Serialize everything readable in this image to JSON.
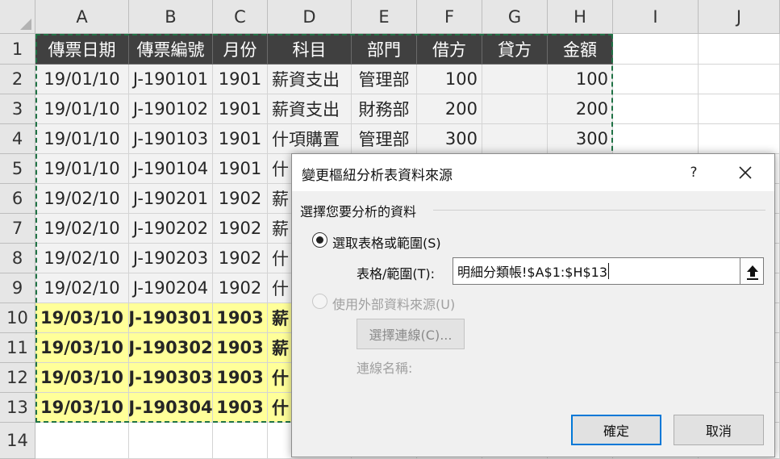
{
  "columns": [
    "A",
    "B",
    "C",
    "D",
    "E",
    "F",
    "G",
    "H",
    "I",
    "J"
  ],
  "rows": [
    "1",
    "2",
    "3",
    "4",
    "5",
    "6",
    "7",
    "8",
    "9",
    "10",
    "11",
    "12",
    "13",
    "14"
  ],
  "headers": [
    "傳票日期",
    "傳票編號",
    "月份",
    "科目",
    "部門",
    "借方",
    "貸方",
    "金額"
  ],
  "data_rows": [
    [
      "19/01/10",
      "J-190101",
      "1901",
      "薪資支出",
      "管理部",
      "100",
      "",
      "100"
    ],
    [
      "19/01/10",
      "J-190102",
      "1901",
      "薪資支出",
      "財務部",
      "200",
      "",
      "200"
    ],
    [
      "19/01/10",
      "J-190103",
      "1901",
      "什項購置",
      "管理部",
      "300",
      "",
      "300"
    ],
    [
      "19/01/10",
      "J-190104",
      "1901",
      "什",
      "",
      "",
      "",
      ""
    ],
    [
      "19/02/10",
      "J-190201",
      "1902",
      "薪",
      "",
      "",
      "",
      ""
    ],
    [
      "19/02/10",
      "J-190202",
      "1902",
      "薪",
      "",
      "",
      "",
      ""
    ],
    [
      "19/02/10",
      "J-190203",
      "1902",
      "什",
      "",
      "",
      "",
      ""
    ],
    [
      "19/02/10",
      "J-190204",
      "1902",
      "什",
      "",
      "",
      "",
      ""
    ],
    [
      "19/03/10",
      "J-190301",
      "1903",
      "薪",
      "",
      "",
      "",
      ""
    ],
    [
      "19/03/10",
      "J-190302",
      "1903",
      "薪",
      "",
      "",
      "",
      ""
    ],
    [
      "19/03/10",
      "J-190303",
      "1903",
      "什",
      "",
      "",
      "",
      ""
    ],
    [
      "19/03/10",
      "J-190304",
      "1903",
      "什",
      "",
      "",
      "",
      ""
    ]
  ],
  "colors": {
    "header_bg": "#404040",
    "gray_fill": "#f2f2f2",
    "yellow_fill": "#ffff99",
    "marquee": "#217346",
    "focus_border": "#0078d7"
  },
  "dialog": {
    "title": "變更樞紐分析表資料來源",
    "help_label": "?",
    "close_icon": "close-icon",
    "group_label": "選擇您要分析的資料",
    "option_table_label": "選取表格或範圍(S)",
    "range_label": "表格/範圍(T):",
    "range_value": "明細分類帳!$A$1:$H$13",
    "collapse_icon": "arrow-up-icon",
    "option_external_label": "使用外部資料來源(U)",
    "choose_connection_label": "選擇連線(C)...",
    "connection_name_label": "連線名稱:",
    "ok_label": "確定",
    "cancel_label": "取消"
  }
}
